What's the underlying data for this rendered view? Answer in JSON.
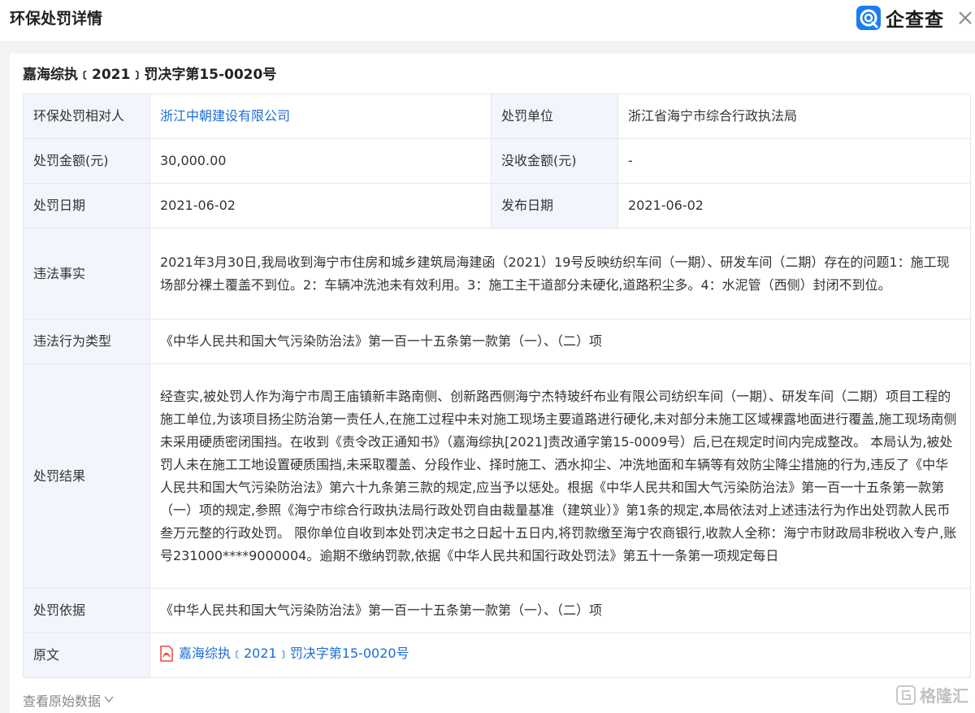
{
  "header": {
    "title": "环保处罚详情",
    "brand": "企查查"
  },
  "document": {
    "title": "嘉海综执﹝2021﹞罚决字第15-0020号"
  },
  "rows": {
    "party_label": "环保处罚相对人",
    "party_value": "浙江中朝建设有限公司",
    "unit_label": "处罚单位",
    "unit_value": "浙江省海宁市综合行政执法局",
    "amount_label": "处罚金额(元)",
    "amount_value": "30,000.00",
    "confiscation_label": "没收金额(元)",
    "confiscation_value": "-",
    "penalty_date_label": "处罚日期",
    "penalty_date_value": "2021-06-02",
    "publish_date_label": "发布日期",
    "publish_date_value": "2021-06-02",
    "facts_label": "违法事实",
    "facts_value": "2021年3月30日,我局收到海宁市住房和城乡建筑局海建函（2021）19号反映纺织车间（一期）、研发车间（二期）存在的问题1：施工现场部分裸土覆盖不到位。2：车辆冲洗池未有效利用。3：施工主干道部分未硬化,道路积尘多。4：水泥管（西侧）封闭不到位。",
    "type_label": "违法行为类型",
    "type_value": "《中华人民共和国大气污染防治法》第一百一十五条第一款第（一）、（二）项",
    "result_label": "处罚结果",
    "result_value": "经查实,被处罚人作为海宁市周王庙镇新丰路南侧、创新路西侧海宁杰特玻纤布业有限公司纺织车间（一期）、研发车间（二期）项目工程的施工单位,为该项目扬尘防治第一责任人,在施工过程中未对施工现场主要道路进行硬化,未对部分未施工区域裸露地面进行覆盖,施工现场南侧未采用硬质密闭围挡。在收到《责令改正通知书》（嘉海综执[2021]责改通字第15-0009号）后,已在规定时间内完成整改。 本局认为,被处罚人未在施工工地设置硬质围挡,未采取覆盖、分段作业、择时施工、洒水抑尘、冲洗地面和车辆等有效防尘降尘措施的行为,违反了《中华人民共和国大气污染防治法》第六十九条第三款的规定,应当予以惩处。根据《中华人民共和国大气污染防治法》第一百一十五条第一款第（一）项的规定,参照《海宁市综合行政执法局行政处罚自由裁量基准（建筑业）》第1条的规定,本局依法对上述违法行为作出处罚款人民币叁万元整的行政处罚。 限你单位自收到本处罚决定书之日起十五日内,将罚款缴至海宁农商银行,收款人全称：海宁市财政局非税收入专户,账号231000****9000004。逾期不缴纳罚款,依据《中华人民共和国行政处罚法》第五十一条第一项规定每日",
    "basis_label": "处罚依据",
    "basis_value": "《中华人民共和国大气污染防治法》第一百一十五条第一款第（一）、（二）项",
    "original_label": "原文",
    "original_value": "嘉海综执﹝2021﹞罚决字第15-0020号"
  },
  "footer": {
    "view_raw_label": "查看原始数据",
    "watermark": "格隆汇"
  },
  "colors": {
    "brand_blue": "#1a7ef0",
    "link": "#1a6dd8",
    "label_bg": "#f2f6fc",
    "border": "#e4e7ee"
  }
}
